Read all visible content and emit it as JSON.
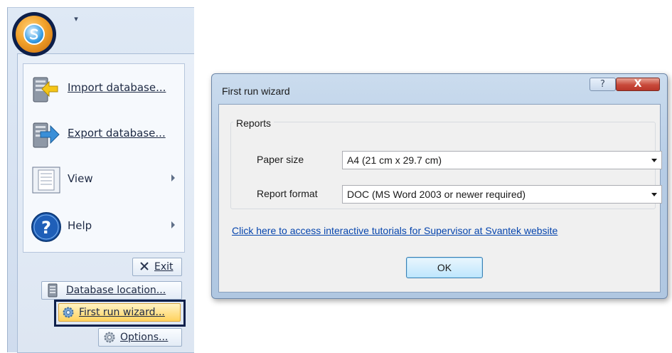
{
  "app_menu": {
    "quick_access_glyph": "▾",
    "items": [
      {
        "label": "Import database...",
        "icon": "import-database-icon",
        "has_submenu": false
      },
      {
        "label": "Export database...",
        "icon": "export-database-icon",
        "has_submenu": false
      },
      {
        "label": "View",
        "icon": "view-icon",
        "has_submenu": true
      },
      {
        "label": "Help",
        "icon": "help-icon",
        "has_submenu": true
      }
    ],
    "exit_label": "Exit",
    "database_location_label": "Database location...",
    "first_run_wizard_label": "First run wizard...",
    "options_label": "Options..."
  },
  "dialog": {
    "title": "First run wizard",
    "help_glyph": "?",
    "close_glyph": "X",
    "group_title": "Reports",
    "paper_size_label": "Paper size",
    "paper_size_value": "A4 (21 cm x 29.7 cm)",
    "report_format_label": "Report format",
    "report_format_value": "DOC (MS Word 2003 or newer required)",
    "tutorial_link": "Click here to access interactive tutorials for Supervisor at Svantek website",
    "ok_label": "OK"
  },
  "colors": {
    "highlight_border": "#0d1f4a",
    "selected_item_bg": "#ffd25e",
    "link": "#0645ad",
    "close_button": "#c8493a"
  }
}
